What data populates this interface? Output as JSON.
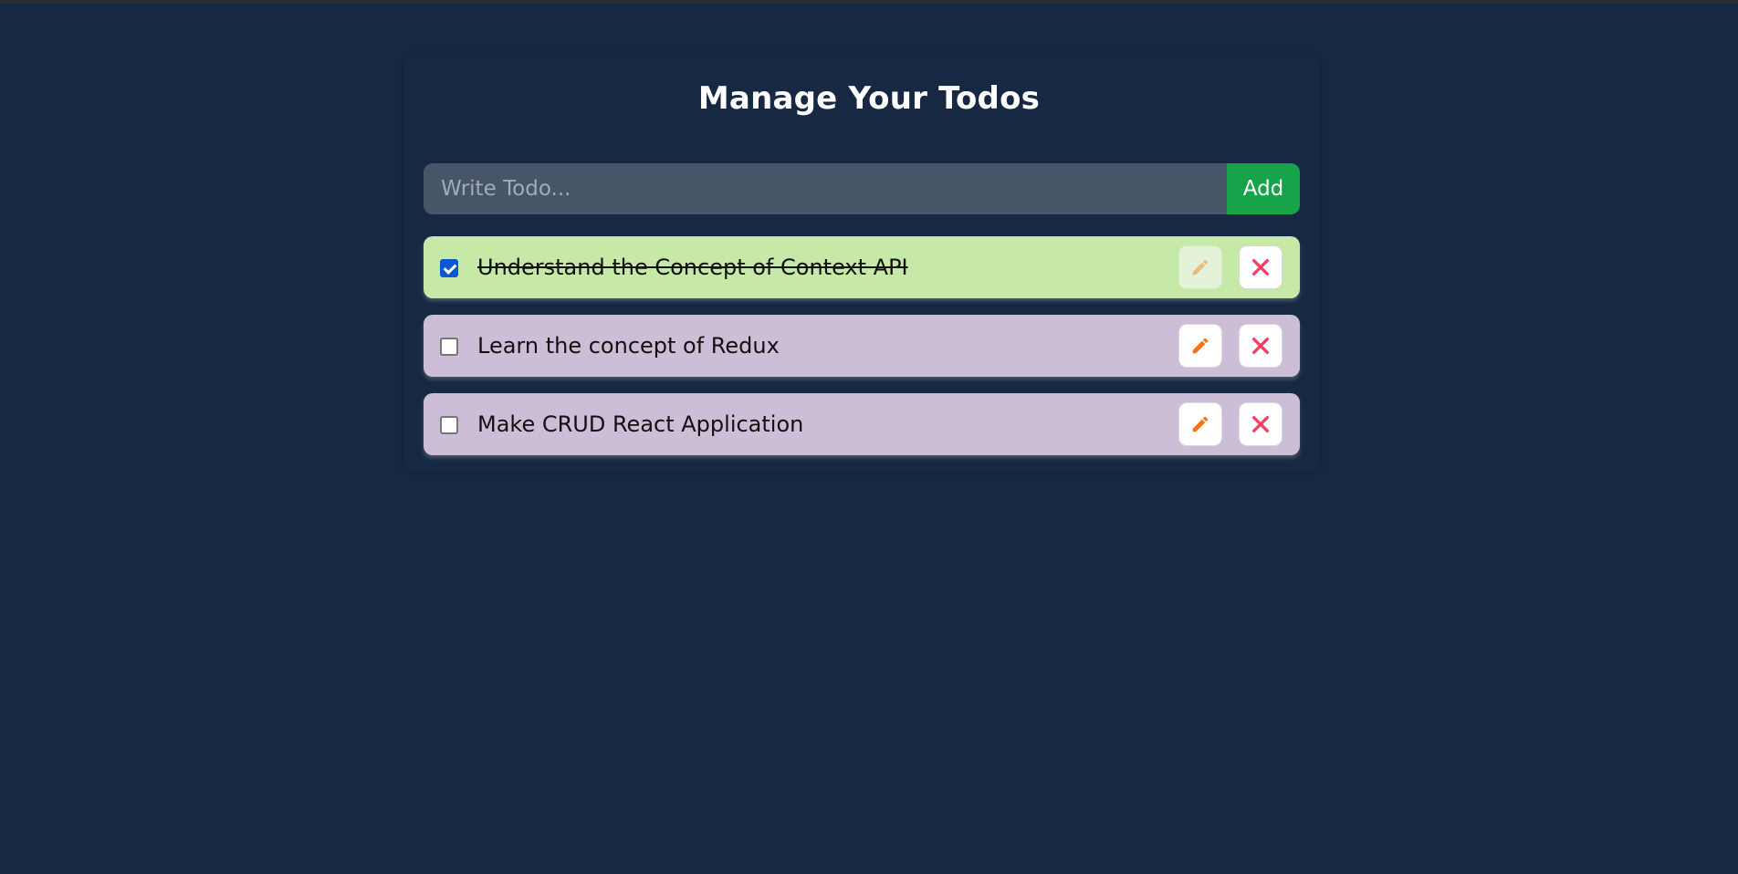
{
  "app": {
    "title": "Manage Your Todos"
  },
  "form": {
    "placeholder": "Write Todo...",
    "value": "",
    "add_label": "Add"
  },
  "todos": [
    {
      "text": "Understand the Concept of Context API",
      "completed": true,
      "edit_icon": "pencil-icon",
      "delete_icon": "close-icon"
    },
    {
      "text": "Learn the concept of Redux",
      "completed": false,
      "edit_icon": "pencil-icon",
      "delete_icon": "close-icon"
    },
    {
      "text": "Make CRUD React Application",
      "completed": false,
      "edit_icon": "pencil-icon",
      "delete_icon": "close-icon"
    }
  ],
  "colors": {
    "background": "#172842",
    "input_bg": "#475569",
    "add_button": "#16a34a",
    "completed_row": "#c6e9a7",
    "pending_row": "#ccbed7",
    "pencil": "#f97316",
    "close": "#f43f5e"
  }
}
